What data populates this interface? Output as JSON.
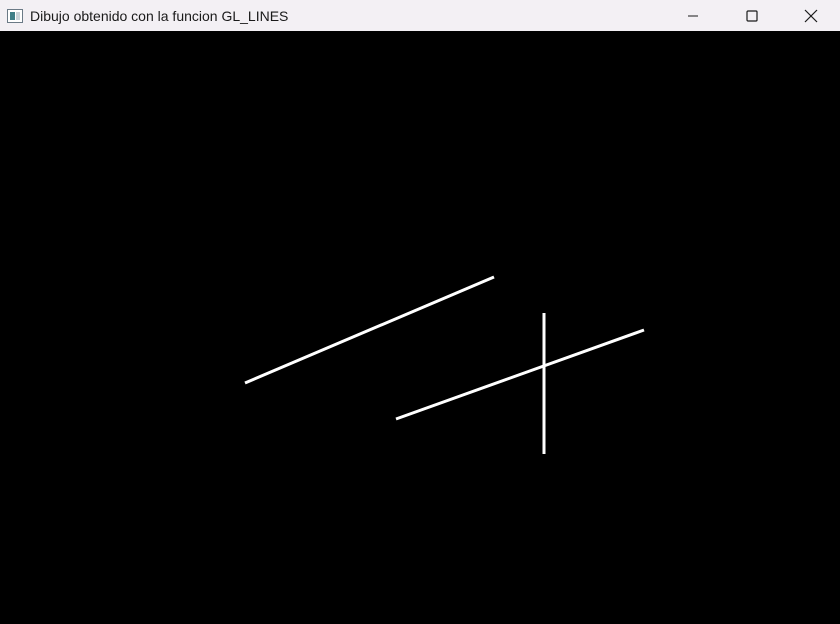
{
  "window": {
    "title": "Dibujo obtenido con la funcion GL_LINES",
    "icon": "opengl-window-icon",
    "controls": [
      "minimize-icon",
      "maximize-icon",
      "close-icon"
    ]
  },
  "colors": {
    "titlebar_bg": "#f3f0f4",
    "canvas_bg": "#000000",
    "line_color": "#ffffff"
  }
}
